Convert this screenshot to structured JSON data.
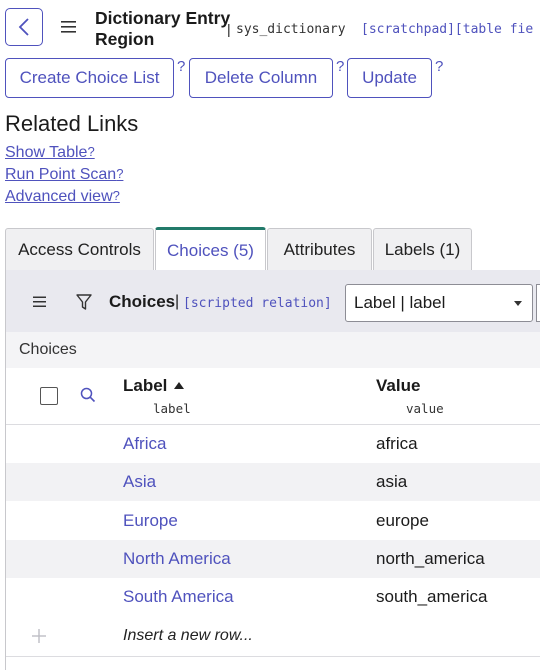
{
  "header": {
    "title": "Dictionary Entry\nRegion",
    "title_line1": "Dictionary Entry",
    "title_line2": "Region",
    "separator": "|",
    "table_name": "sys_dictionary",
    "scratchpad_hint": "[scratchpad][table fie"
  },
  "actions": {
    "create_choice_list": "Create Choice List",
    "delete_column": "Delete Column",
    "update": "Update",
    "help_mark": "?"
  },
  "related_links": {
    "heading": "Related Links",
    "items": [
      {
        "label": "Show Table",
        "help": "?"
      },
      {
        "label": "Run Point Scan",
        "help": "?"
      },
      {
        "label": "Advanced view",
        "help": "?"
      }
    ]
  },
  "tabs": [
    {
      "label": "Access Controls",
      "active": false
    },
    {
      "label": "Choices (5)",
      "active": true
    },
    {
      "label": "Attributes",
      "active": false
    },
    {
      "label": "Labels (1)",
      "active": false
    }
  ],
  "list": {
    "title": "Choices",
    "separator": "|",
    "scripted_relation": "[scripted relation]",
    "search_field": "Label | label",
    "caption": "Choices",
    "columns": [
      {
        "header": "Label",
        "field": "label",
        "sorted": "ascending"
      },
      {
        "header": "Value",
        "field": "value"
      }
    ],
    "rows": [
      {
        "label": "Africa",
        "value": "africa"
      },
      {
        "label": "Asia",
        "value": "asia"
      },
      {
        "label": "Europe",
        "value": "europe"
      },
      {
        "label": "North America",
        "value": "north_america"
      },
      {
        "label": "South America",
        "value": "south_america"
      }
    ],
    "insert_row": "Insert a new row..."
  },
  "colors": {
    "accent": "#4f52bd",
    "active_tab_border": "#227a6a",
    "toolbar_bg": "#e9e9ef"
  }
}
